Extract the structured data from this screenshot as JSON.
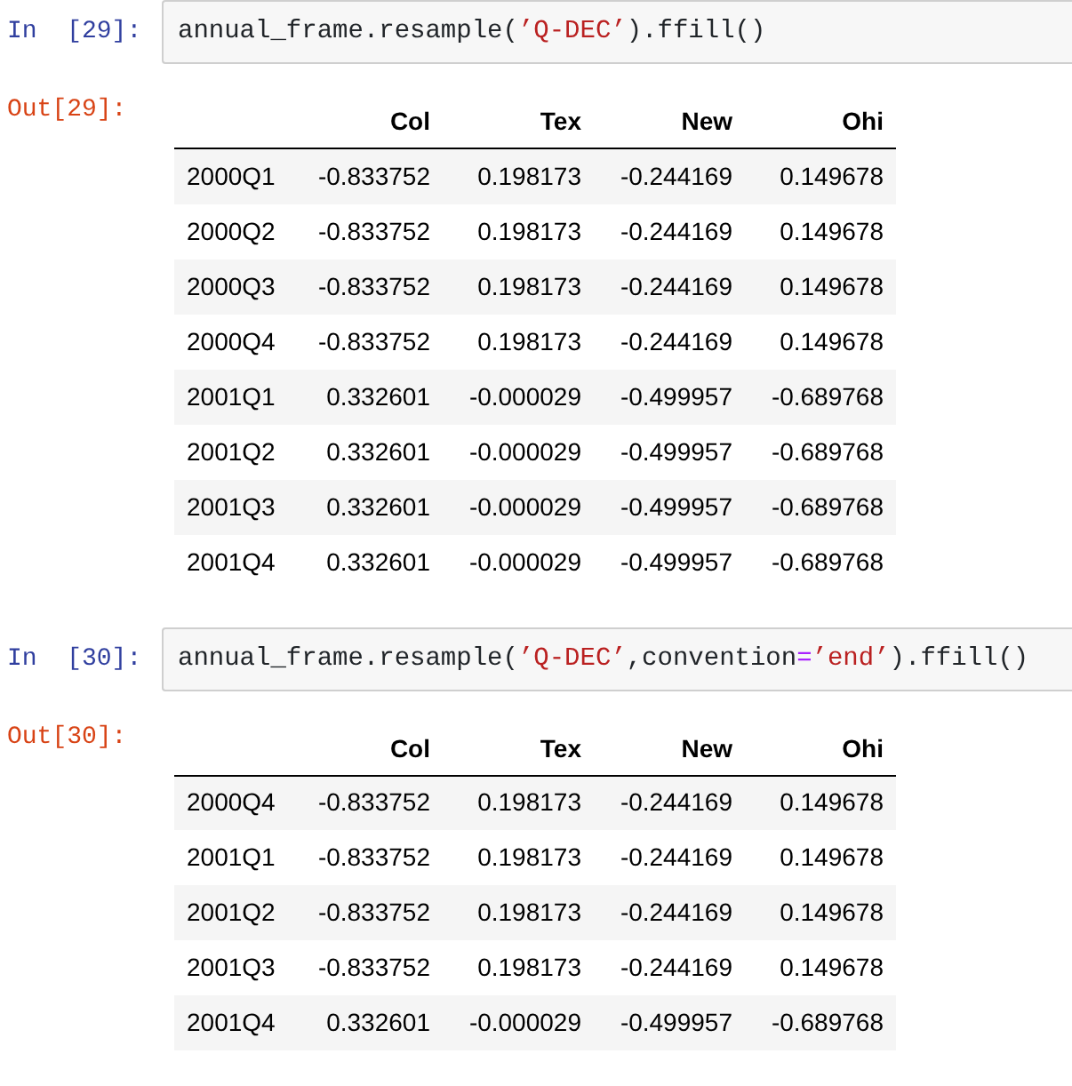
{
  "cells": [
    {
      "in_prompt": "In  [29]:",
      "code": [
        {
          "kind": "plain",
          "text": "annual_frame.resample("
        },
        {
          "kind": "string",
          "text": "’Q-DEC’"
        },
        {
          "kind": "plain",
          "text": ").ffill()"
        }
      ],
      "out_prompt": "Out[29]:",
      "table": {
        "columns": [
          "",
          "Col",
          "Tex",
          "New",
          "Ohi"
        ],
        "rows": [
          [
            "2000Q1",
            "-0.833752",
            "0.198173",
            "-0.244169",
            "0.149678"
          ],
          [
            "2000Q2",
            "-0.833752",
            "0.198173",
            "-0.244169",
            "0.149678"
          ],
          [
            "2000Q3",
            "-0.833752",
            "0.198173",
            "-0.244169",
            "0.149678"
          ],
          [
            "2000Q4",
            "-0.833752",
            "0.198173",
            "-0.244169",
            "0.149678"
          ],
          [
            "2001Q1",
            "0.332601",
            "-0.000029",
            "-0.499957",
            "-0.689768"
          ],
          [
            "2001Q2",
            "0.332601",
            "-0.000029",
            "-0.499957",
            "-0.689768"
          ],
          [
            "2001Q3",
            "0.332601",
            "-0.000029",
            "-0.499957",
            "-0.689768"
          ],
          [
            "2001Q4",
            "0.332601",
            "-0.000029",
            "-0.499957",
            "-0.689768"
          ]
        ]
      }
    },
    {
      "in_prompt": "In  [30]:",
      "code": [
        {
          "kind": "plain",
          "text": "annual_frame.resample("
        },
        {
          "kind": "string",
          "text": "’Q-DEC’"
        },
        {
          "kind": "plain",
          "text": ",convention"
        },
        {
          "kind": "operator",
          "text": "="
        },
        {
          "kind": "string",
          "text": "’end’"
        },
        {
          "kind": "plain",
          "text": ").ffill()"
        }
      ],
      "out_prompt": "Out[30]:",
      "table": {
        "columns": [
          "",
          "Col",
          "Tex",
          "New",
          "Ohi"
        ],
        "rows": [
          [
            "2000Q4",
            "-0.833752",
            "0.198173",
            "-0.244169",
            "0.149678"
          ],
          [
            "2001Q1",
            "-0.833752",
            "0.198173",
            "-0.244169",
            "0.149678"
          ],
          [
            "2001Q2",
            "-0.833752",
            "0.198173",
            "-0.244169",
            "0.149678"
          ],
          [
            "2001Q3",
            "-0.833752",
            "0.198173",
            "-0.244169",
            "0.149678"
          ],
          [
            "2001Q4",
            "0.332601",
            "-0.000029",
            "-0.499957",
            "-0.689768"
          ]
        ]
      }
    }
  ]
}
